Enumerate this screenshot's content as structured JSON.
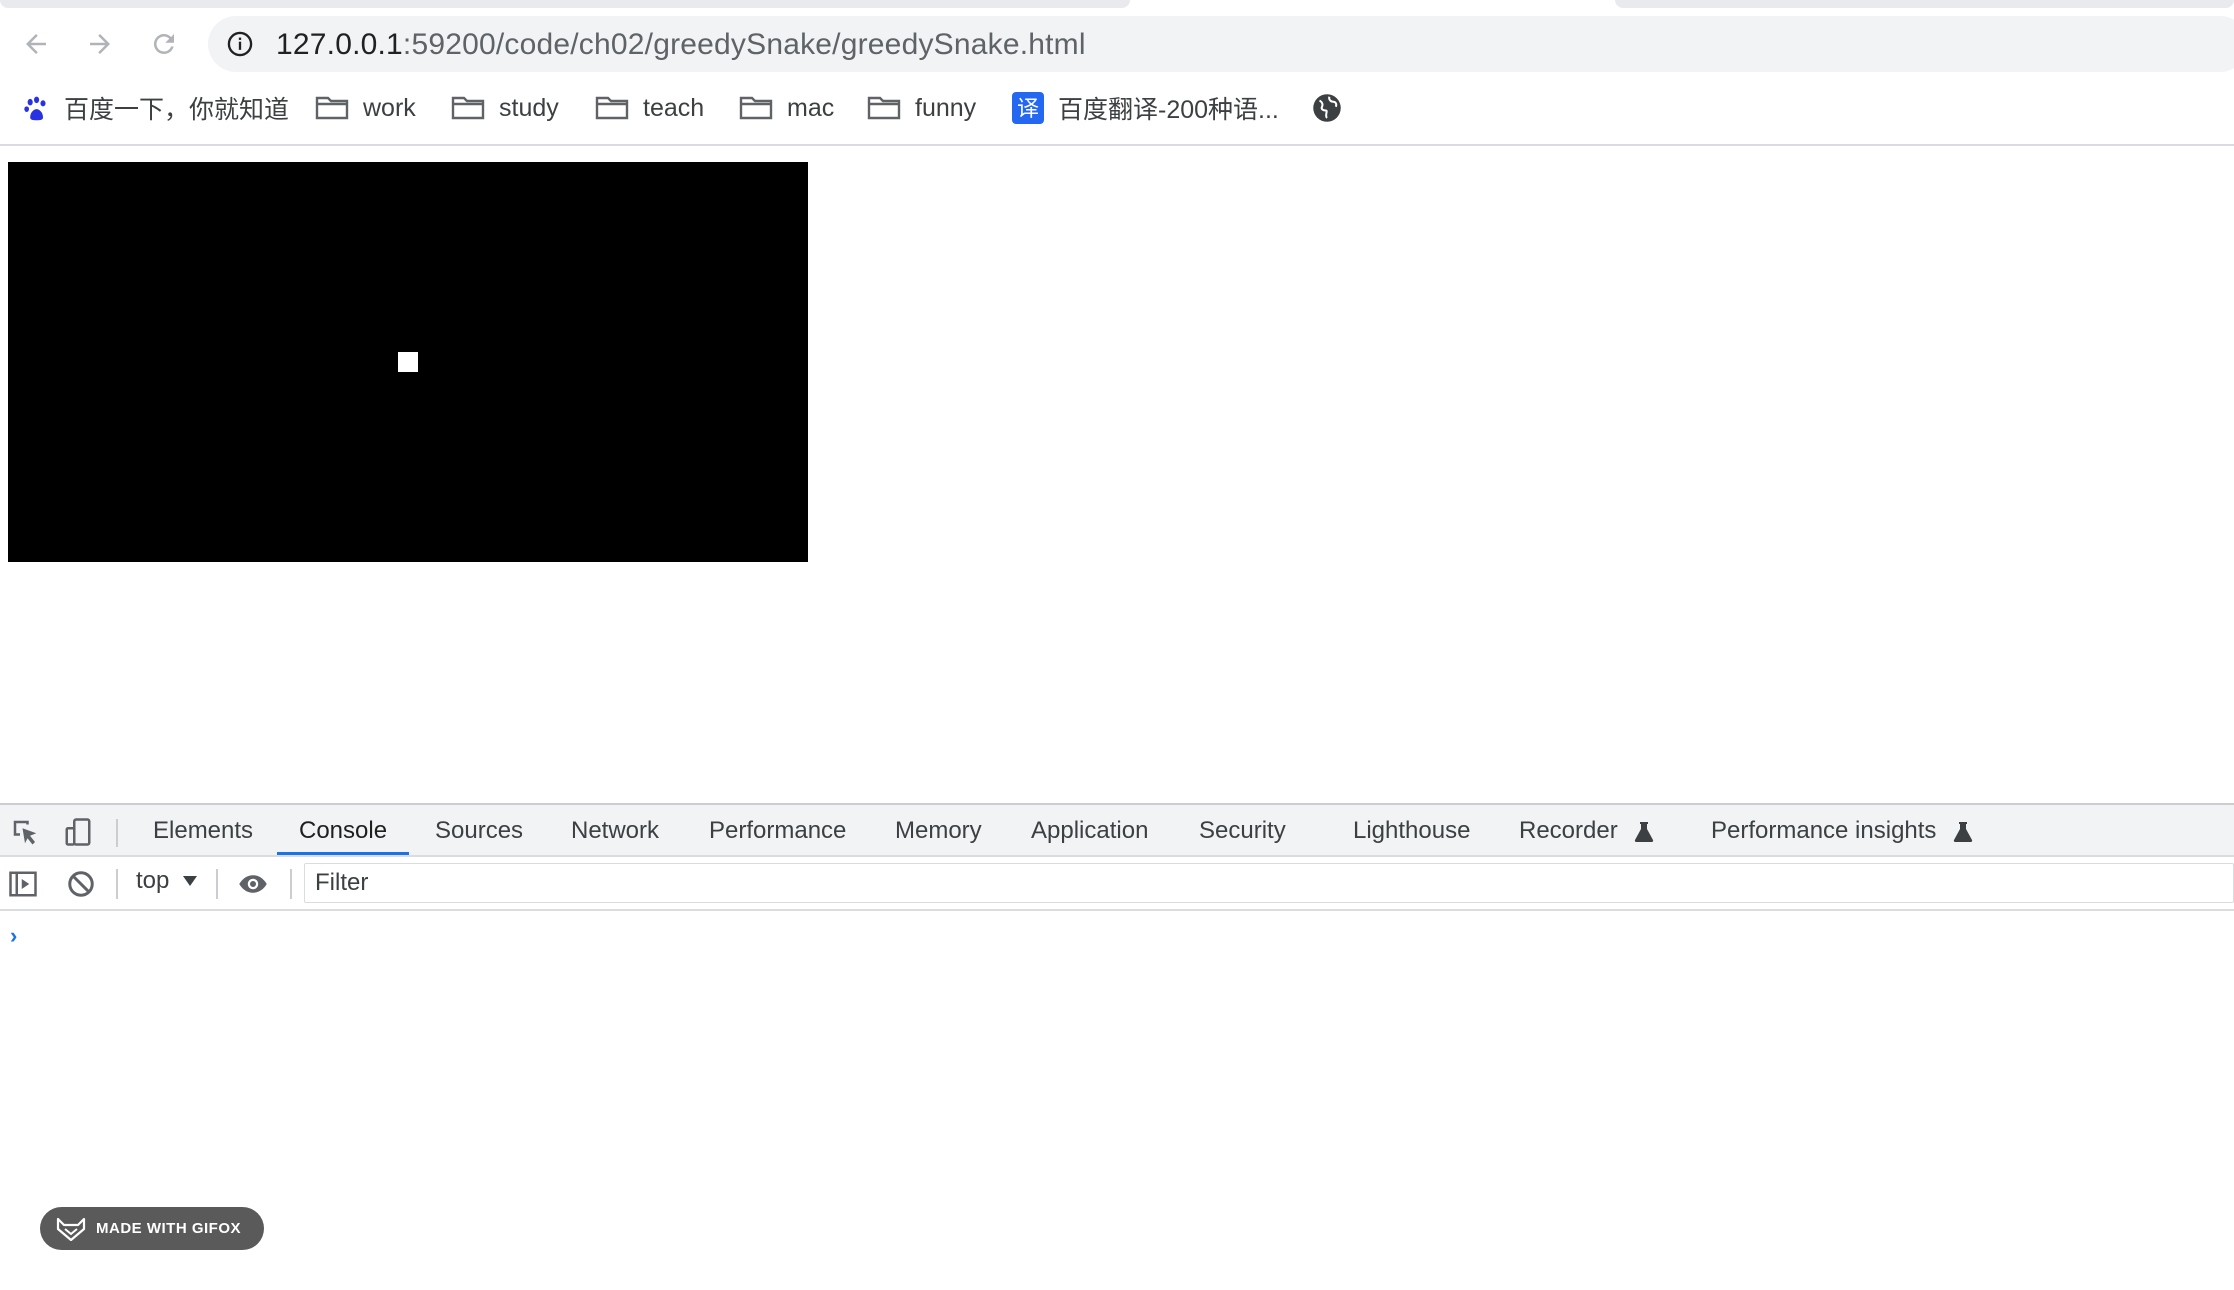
{
  "browser": {
    "url_host": "127.0.0.1",
    "url_path": ":59200/code/ch02/greedySnake/greedySnake.html"
  },
  "bookmarks": [
    {
      "label": "百度一下，你就知道",
      "icon": "baidu-paw-icon"
    },
    {
      "label": "work",
      "icon": "folder-icon"
    },
    {
      "label": "study",
      "icon": "folder-icon"
    },
    {
      "label": "teach",
      "icon": "folder-icon"
    },
    {
      "label": "mac",
      "icon": "folder-icon"
    },
    {
      "label": "funny",
      "icon": "folder-icon"
    },
    {
      "label": "百度翻译-200种语...",
      "icon": "translate-icon"
    },
    {
      "label": "",
      "icon": "globe-icon"
    }
  ],
  "page": {
    "canvas_color": "#000000",
    "food_color": "#ffffff"
  },
  "devtools": {
    "tabs": [
      "Elements",
      "Console",
      "Sources",
      "Network",
      "Performance",
      "Memory",
      "Application",
      "Security",
      "Lighthouse",
      "Recorder",
      "Performance insights"
    ],
    "active_tab": "Console",
    "console": {
      "context": "top",
      "filter_placeholder": "Filter",
      "prompt": "›"
    }
  },
  "watermark": {
    "label": "MADE WITH GIFOX"
  },
  "colors": {
    "accent": "#1a73e8"
  }
}
